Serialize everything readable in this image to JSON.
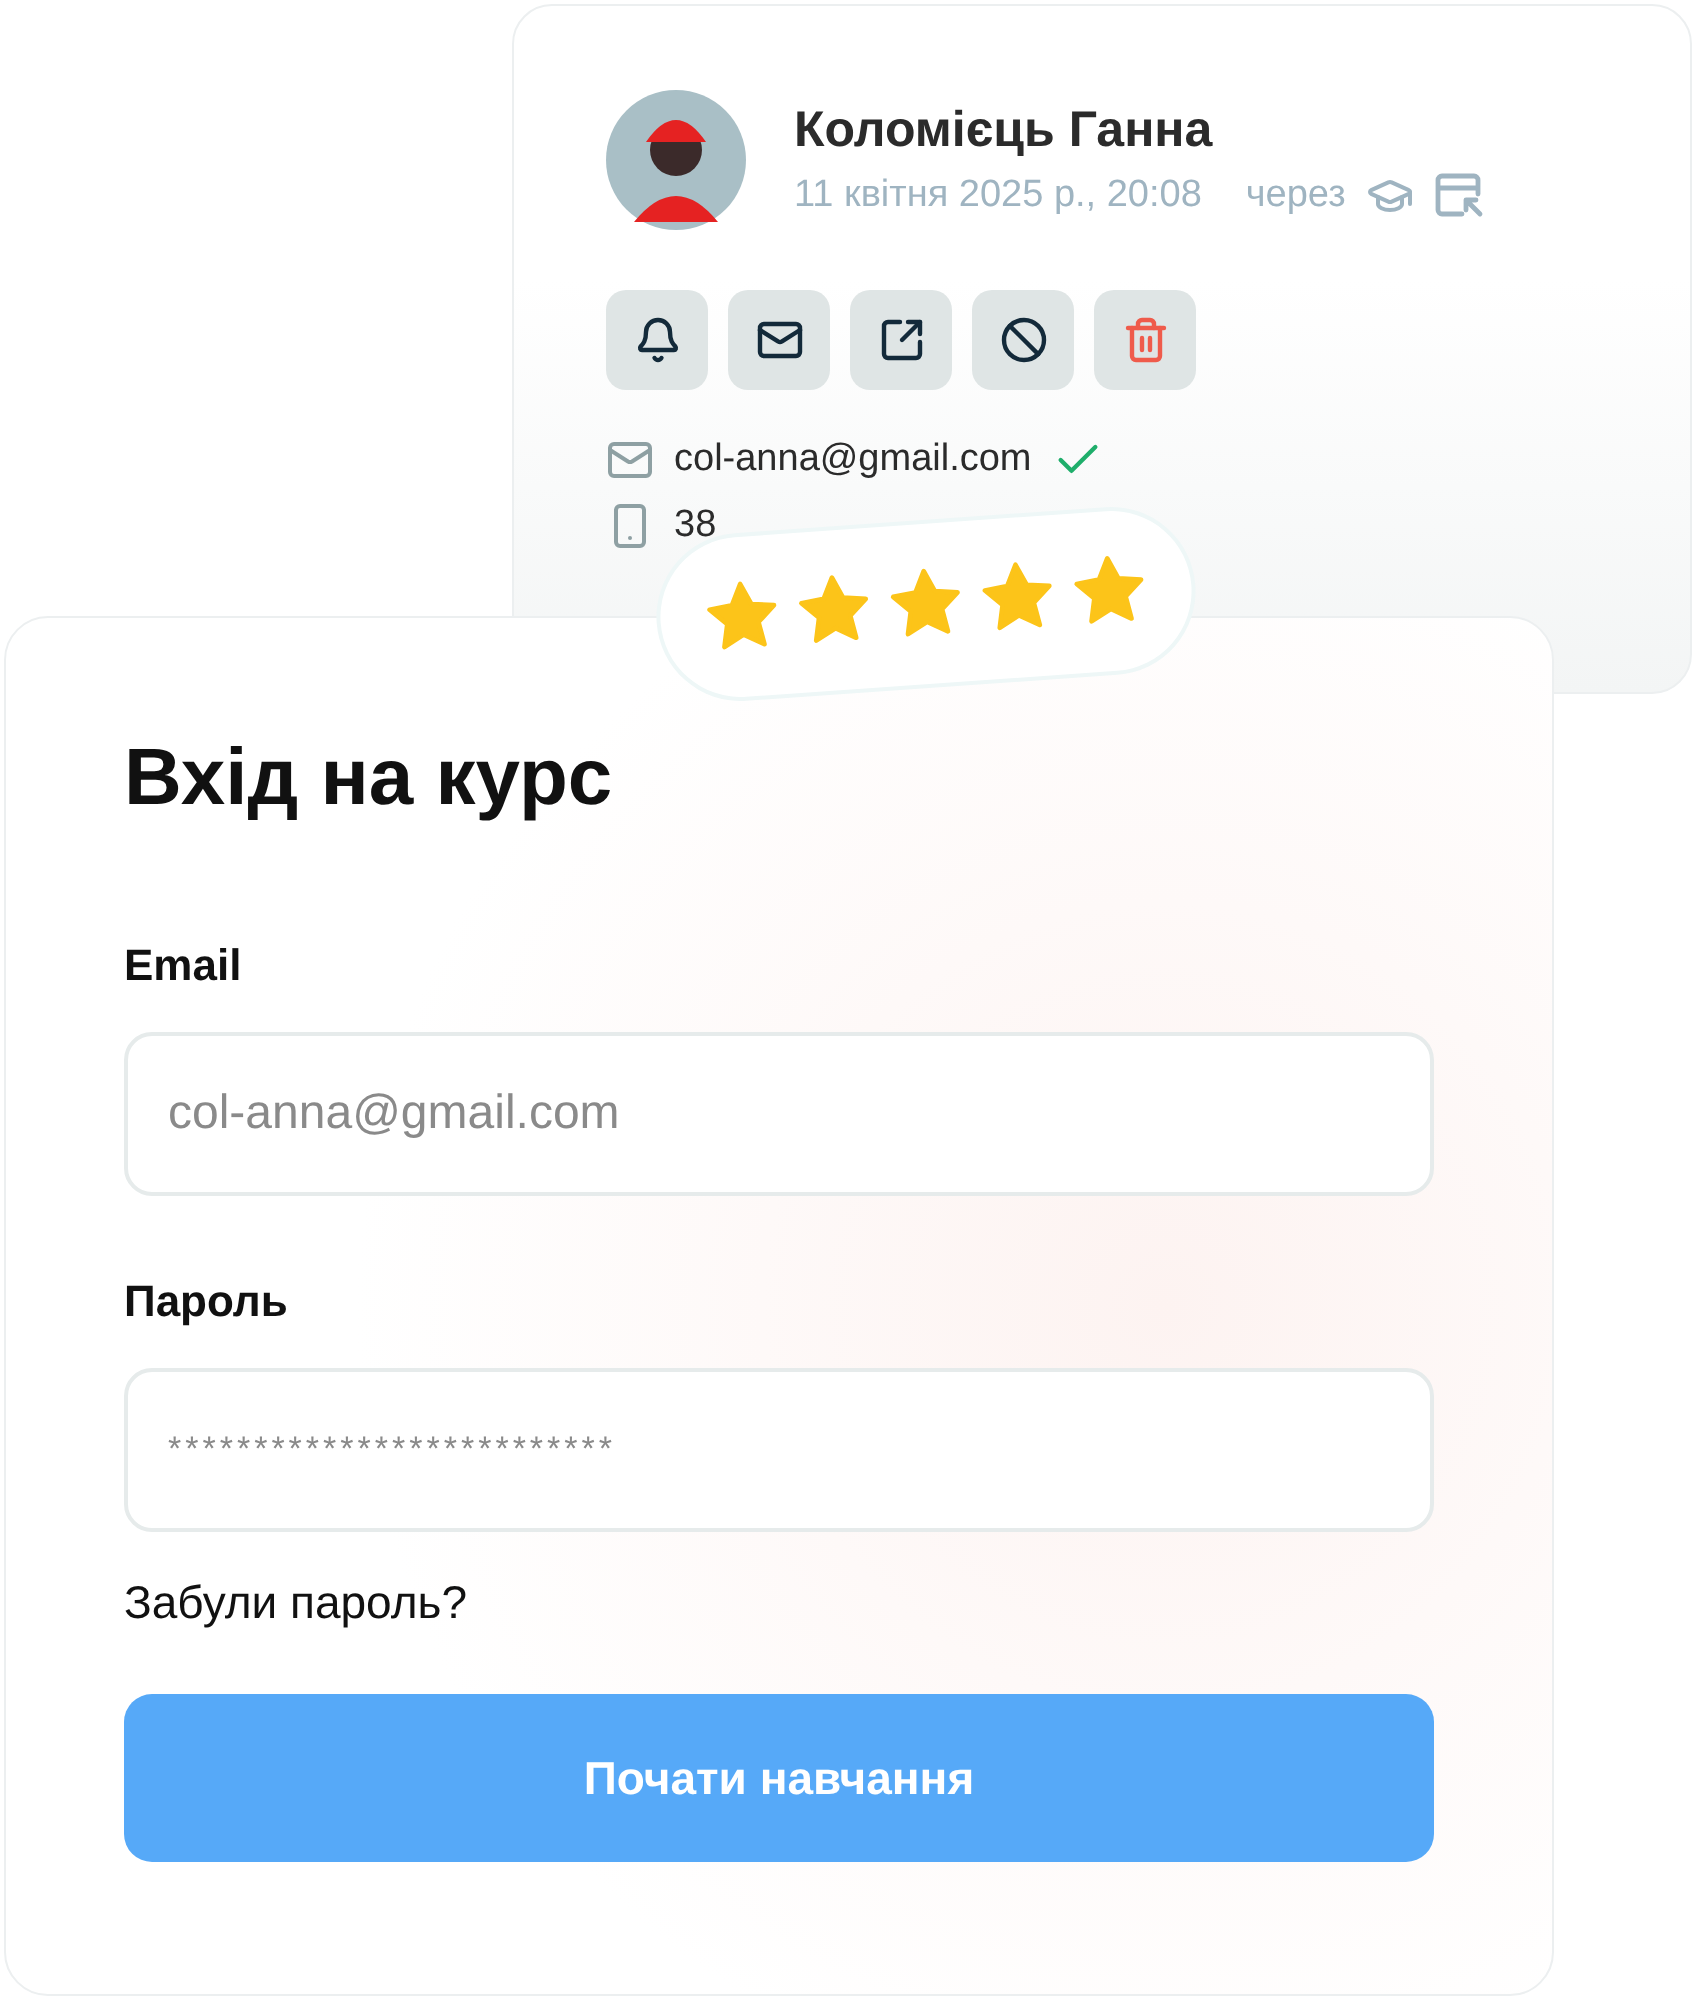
{
  "profile_card": {
    "name": "Коломієць Ганна",
    "date": "11 квітня 2025 р., 20:08",
    "via": "через",
    "actions": [
      {
        "kind": "bell"
      },
      {
        "kind": "mail"
      },
      {
        "kind": "external"
      },
      {
        "kind": "block"
      },
      {
        "kind": "delete"
      }
    ],
    "contacts": [
      {
        "kind": "email",
        "text": "col-anna@gmail.com",
        "verified": true
      },
      {
        "kind": "phone",
        "text": "38",
        "verified": false
      }
    ]
  },
  "rating": {
    "stars": 5
  },
  "login": {
    "title": "Вхід на курс",
    "fields": [
      {
        "label": "Email",
        "value": "col-anna@gmail.com"
      },
      {
        "label": "Пароль",
        "value": "**************************"
      }
    ],
    "forgot_link": "Забули пароль?",
    "submit": "Почати навчання"
  }
}
